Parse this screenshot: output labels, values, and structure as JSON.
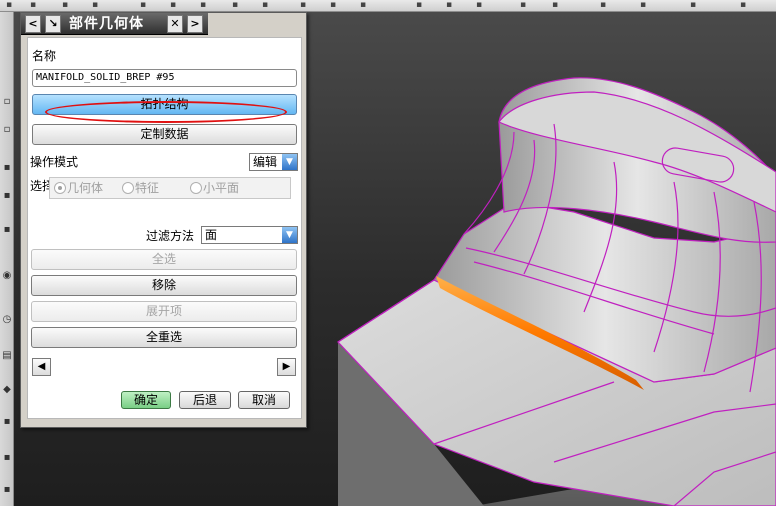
{
  "dialog": {
    "title": "部件几何体",
    "name_label": "名称",
    "name_value": "MANIFOLD_SOLID_BREP #95",
    "topology_button": "拓扑结构",
    "custom_data_button": "定制数据",
    "operation_mode_label": "操作模式",
    "operation_mode_value": "编辑",
    "selection_options_label": "选择选项",
    "radio_options": [
      {
        "label": "几何体",
        "selected": true
      },
      {
        "label": "特征",
        "selected": false
      },
      {
        "label": "小平面",
        "selected": false
      }
    ],
    "filter_method_label": "过滤方法",
    "filter_method_value": "面",
    "select_all_button": "全选",
    "remove_button": "移除",
    "expand_items_button": "展开项",
    "reselect_all_button": "全重选",
    "ok_button": "确定",
    "back_button": "后退",
    "cancel_button": "取消"
  },
  "icons": [
    "back-arrow-icon",
    "select-arrow-icon",
    "close-icon",
    "forward-arrow-icon",
    "left-arrow-icon",
    "right-arrow-icon",
    "dropdown-arrow-icon"
  ],
  "colors": {
    "titlebar": "#3a3a3a",
    "primary_button": "#64b7f2",
    "ok_button": "#79cf85",
    "highlight_ellipse": "#e01010",
    "model_edges": "#c020c0",
    "selected_face": "#ff8c1a"
  }
}
